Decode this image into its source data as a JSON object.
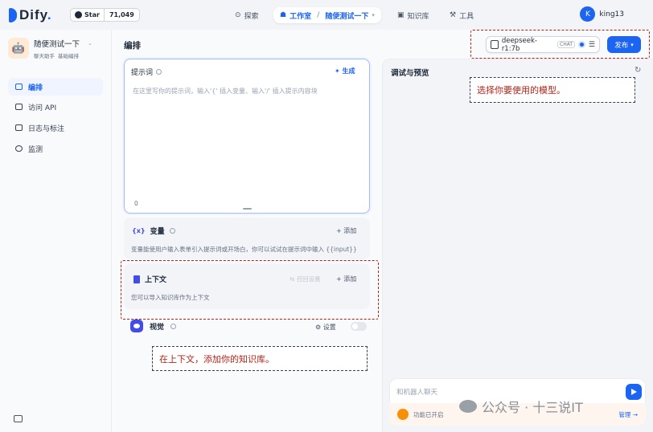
{
  "brand": {
    "name": "Dify",
    "star_label": "Star",
    "star_count": "71,049"
  },
  "nav": {
    "explore": "探索",
    "studio": "工作室",
    "app_name": "随便测试一下",
    "knowledge": "知识库",
    "tools": "工具"
  },
  "user": {
    "initial": "K",
    "name": "king13"
  },
  "app": {
    "name": "随便测试一下",
    "tag_type": "聊天助手",
    "tag_mode": "基础编排"
  },
  "sidebar": {
    "items": [
      {
        "label": "编排",
        "icon": "layout-icon",
        "active": true
      },
      {
        "label": "访问 API",
        "icon": "terminal-icon",
        "active": false
      },
      {
        "label": "日志与标注",
        "icon": "log-icon",
        "active": false
      },
      {
        "label": "监测",
        "icon": "monitor-icon",
        "active": false
      }
    ]
  },
  "main": {
    "title": "编排"
  },
  "model": {
    "name": "deepseek-r1:7b",
    "badge": "CHAT"
  },
  "publish": {
    "label": "发布"
  },
  "prompt": {
    "label": "提示词",
    "generate": "生成",
    "placeholder": "在这里写你的提示词，输入'{' 插入变量、输入'/' 插入提示内容块",
    "count": "0"
  },
  "variables": {
    "title": "变量",
    "add": "添加",
    "desc": "变量能使用户输入表单引入提示词或开场白，你可以试试在提示词中输入 {{input}}"
  },
  "context": {
    "title": "上下文",
    "retrieval": "召回设置",
    "add": "添加",
    "desc": "您可以导入知识库作为上下文"
  },
  "vision": {
    "title": "视觉",
    "settings": "设置"
  },
  "annotations": {
    "model": "选择你要使用的模型。",
    "context": "在上下文，添加你的知识库。"
  },
  "debug": {
    "title": "调试与预览",
    "input_placeholder": "和机器人聊天",
    "feature_text": "功能已开启",
    "manage": "管理"
  },
  "watermark": {
    "text": "公众号 · 十三说IT"
  }
}
